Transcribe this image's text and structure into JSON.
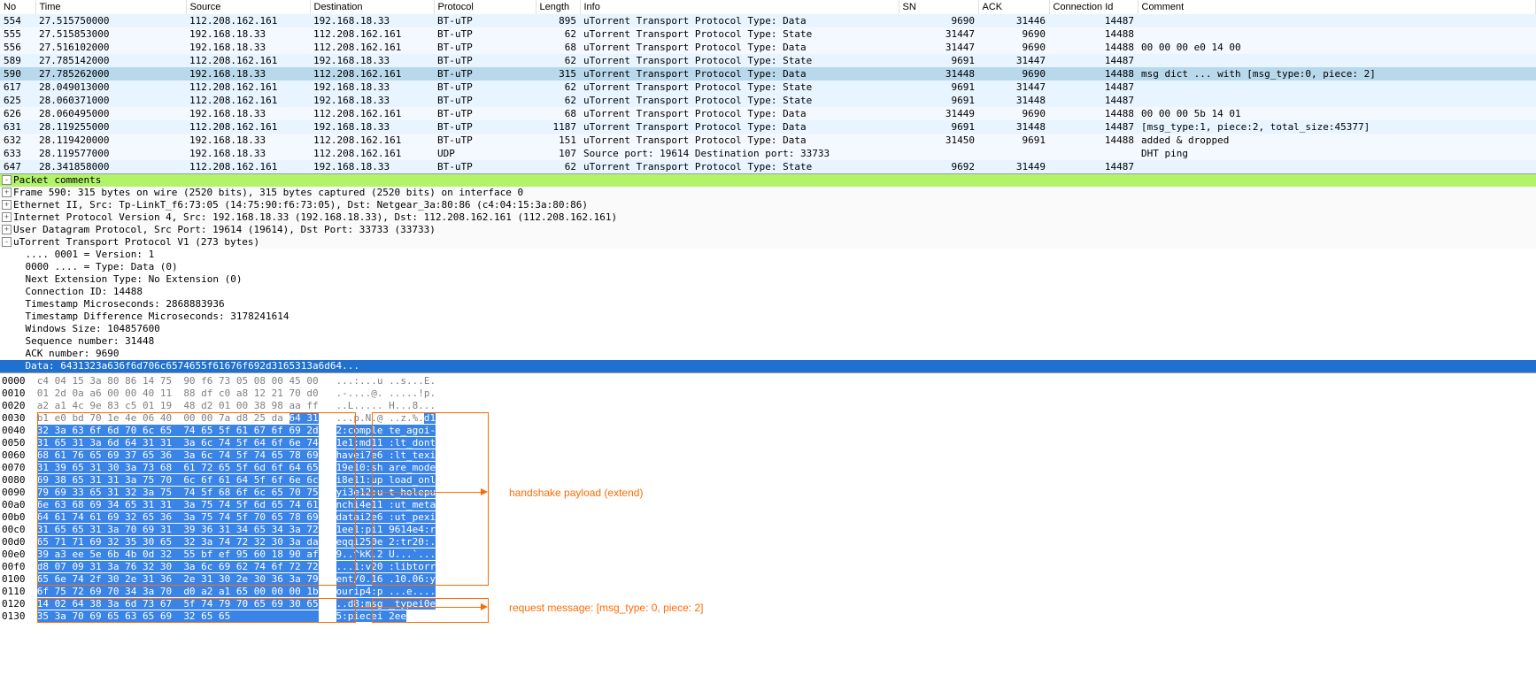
{
  "columns": {
    "no": "No",
    "time": "Time",
    "source": "Source",
    "destination": "Destination",
    "protocol": "Protocol",
    "length": "Length",
    "info": "Info",
    "sn": "SN",
    "ack": "ACK",
    "cid": "Connection Id",
    "comment": "Comment"
  },
  "rows": [
    {
      "no": "554",
      "time": "27.515750000",
      "src": "112.208.162.161",
      "dst": "192.168.18.33",
      "proto": "BT-uTP",
      "len": "895",
      "info": "uTorrent Transport Protocol Type: Data",
      "sn": "9690",
      "ack": "31446",
      "cid": "14487",
      "cmt": "",
      "cls": "row-ip1"
    },
    {
      "no": "555",
      "time": "27.515853000",
      "src": "192.168.18.33",
      "dst": "112.208.162.161",
      "proto": "BT-uTP",
      "len": "62",
      "info": "uTorrent Transport Protocol Type: State",
      "sn": "31447",
      "ack": "9690",
      "cid": "14488",
      "cmt": "",
      "cls": "row-ip2"
    },
    {
      "no": "556",
      "time": "27.516102000",
      "src": "192.168.18.33",
      "dst": "112.208.162.161",
      "proto": "BT-uTP",
      "len": "68",
      "info": "uTorrent Transport Protocol Type: Data",
      "sn": "31447",
      "ack": "9690",
      "cid": "14488",
      "cmt": "00 00 00 e0 14 00",
      "cls": "row-ip2"
    },
    {
      "no": "589",
      "time": "27.785142000",
      "src": "112.208.162.161",
      "dst": "192.168.18.33",
      "proto": "BT-uTP",
      "len": "62",
      "info": "uTorrent Transport Protocol Type: State",
      "sn": "9691",
      "ack": "31447",
      "cid": "14487",
      "cmt": "",
      "cls": "row-ip1"
    },
    {
      "no": "590",
      "time": "27.785262000",
      "src": "192.168.18.33",
      "dst": "112.208.162.161",
      "proto": "BT-uTP",
      "len": "315",
      "info": "uTorrent Transport Protocol Type: Data",
      "sn": "31448",
      "ack": "9690",
      "cid": "14488",
      "cmt": "msg dict ... with [msg_type:0, piece: 2]",
      "cls": "row-selected"
    },
    {
      "no": "617",
      "time": "28.049013000",
      "src": "112.208.162.161",
      "dst": "192.168.18.33",
      "proto": "BT-uTP",
      "len": "62",
      "info": "uTorrent Transport Protocol Type: State",
      "sn": "9691",
      "ack": "31447",
      "cid": "14487",
      "cmt": "",
      "cls": "row-ip1"
    },
    {
      "no": "625",
      "time": "28.060371000",
      "src": "112.208.162.161",
      "dst": "192.168.18.33",
      "proto": "BT-uTP",
      "len": "62",
      "info": "uTorrent Transport Protocol Type: State",
      "sn": "9691",
      "ack": "31448",
      "cid": "14487",
      "cmt": "",
      "cls": "row-ip1"
    },
    {
      "no": "626",
      "time": "28.060495000",
      "src": "192.168.18.33",
      "dst": "112.208.162.161",
      "proto": "BT-uTP",
      "len": "68",
      "info": "uTorrent Transport Protocol Type: Data",
      "sn": "31449",
      "ack": "9690",
      "cid": "14488",
      "cmt": "00 00 00 5b 14 01",
      "cls": "row-ip2"
    },
    {
      "no": "631",
      "time": "28.119255000",
      "src": "112.208.162.161",
      "dst": "192.168.18.33",
      "proto": "BT-uTP",
      "len": "1187",
      "info": "uTorrent Transport Protocol Type: Data",
      "sn": "9691",
      "ack": "31448",
      "cid": "14487",
      "cmt": "[msg_type:1, piece:2, total_size:45377]",
      "cls": "row-ip1"
    },
    {
      "no": "632",
      "time": "28.119420000",
      "src": "192.168.18.33",
      "dst": "112.208.162.161",
      "proto": "BT-uTP",
      "len": "151",
      "info": "uTorrent Transport Protocol Type: Data",
      "sn": "31450",
      "ack": "9691",
      "cid": "14488",
      "cmt": "added & dropped",
      "cls": "row-ip2"
    },
    {
      "no": "633",
      "time": "28.119577000",
      "src": "192.168.18.33",
      "dst": "112.208.162.161",
      "proto": "UDP",
      "len": "107",
      "info": "Source port: 19614  Destination port: 33733",
      "sn": "",
      "ack": "",
      "cid": "",
      "cmt": "DHT ping",
      "cls": "row-ip2"
    },
    {
      "no": "647",
      "time": "28.341858000",
      "src": "112.208.162.161",
      "dst": "192.168.18.33",
      "proto": "BT-uTP",
      "len": "62",
      "info": "uTorrent Transport Protocol Type: State",
      "sn": "9692",
      "ack": "31449",
      "cid": "14487",
      "cmt": "",
      "cls": "row-ip1"
    }
  ],
  "details": {
    "comments_hdr": "Packet comments",
    "lines": [
      "Frame 590: 315 bytes on wire (2520 bits), 315 bytes captured (2520 bits) on interface 0",
      "Ethernet II, Src: Tp-LinkT_f6:73:05 (14:75:90:f6:73:05), Dst: Netgear_3a:80:86 (c4:04:15:3a:80:86)",
      "Internet Protocol Version 4, Src: 192.168.18.33 (192.168.18.33), Dst: 112.208.162.161 (112.208.162.161)",
      "User Datagram Protocol, Src Port: 19614 (19614), Dst Port: 33733 (33733)",
      "uTorrent Transport Protocol V1 (273 bytes)"
    ],
    "utp": [
      ".... 0001 = Version: 1",
      "0000 .... = Type: Data (0)",
      "Next Extension Type: No Extension (0)",
      "Connection ID: 14488",
      "Timestamp Microseconds: 2868883936",
      "Timestamp Difference Microseconds: 3178241614",
      "Windows Size: 104857600",
      "Sequence number: 31448",
      "ACK number: 9690"
    ],
    "data_line": "Data: 6431323a636f6d706c6574655f61676f692d3165313a6d64..."
  },
  "hex": [
    {
      "off": "0000",
      "b": "c4 04 15 3a 80 86 14 75  90 f6 73 05 08 00 45 00",
      "a": "...:...u ..s...E.",
      "sel": false
    },
    {
      "off": "0010",
      "b": "01 2d 0a a6 00 00 40 11  88 df c0 a8 12 21 70 d0",
      "a": ".-....@. .....!p.",
      "sel": false
    },
    {
      "off": "0020",
      "b": "a2 a1 4c 9e 83 c5 01 19  48 d2 01 00 38 98 aa ff",
      "a": "..L..... H...8...",
      "sel": false
    },
    {
      "off": "0030",
      "b": "b1 e0 bd 70 1e 4e 06 40  00 00 7a d8 25 da ",
      "bs": "64 31",
      "a": "...p.N.@ ..z.%.",
      "as": "d1",
      "sel": "partial"
    },
    {
      "off": "0040",
      "b": "32 3a 63 6f 6d 70 6c 65  74 65 5f 61 67 6f 69 2d",
      "a": "2:comple te_agoi-",
      "sel": true
    },
    {
      "off": "0050",
      "b": "31 65 31 3a 6d 64 31 31  3a 6c 74 5f 64 6f 6e 74",
      "a": "1e1:md11 :lt_dont",
      "sel": true
    },
    {
      "off": "0060",
      "b": "68 61 76 65 69 37 65 36  3a 6c 74 5f 74 65 78 69",
      "a": "havei7e6 :lt_texi",
      "sel": true
    },
    {
      "off": "0070",
      "b": "31 39 65 31 30 3a 73 68  61 72 65 5f 6d 6f 64 65",
      "a": "19e10:sh are_mode",
      "sel": true
    },
    {
      "off": "0080",
      "b": "69 38 65 31 31 3a 75 70  6c 6f 61 64 5f 6f 6e 6c",
      "a": "i8e11:up load_onl",
      "sel": true
    },
    {
      "off": "0090",
      "b": "79 69 33 65 31 32 3a 75  74 5f 68 6f 6c 65 70 75",
      "a": "yi3e12:u t_holepu",
      "sel": true
    },
    {
      "off": "00a0",
      "b": "6e 63 68 69 34 65 31 31  3a 75 74 5f 6d 65 74 61",
      "a": "nchi4e11 :ut_meta",
      "sel": true
    },
    {
      "off": "00b0",
      "b": "64 61 74 61 69 32 65 36  3a 75 74 5f 70 65 78 69",
      "a": "datai2e6 :ut_pexi",
      "sel": true
    },
    {
      "off": "00c0",
      "b": "31 65 65 31 3a 70 69 31  39 36 31 34 65 34 3a 72",
      "a": "1ee1:pi1 9614e4:r",
      "sel": true
    },
    {
      "off": "00d0",
      "b": "65 71 71 69 32 35 30 65  32 3a 74 72 32 30 3a da",
      "a": "eqqi250e 2:tr20:.",
      "sel": true
    },
    {
      "off": "00e0",
      "b": "39 a3 ee 5e 6b 4b 0d 32  55 bf ef 95 60 18 90 af",
      "a": "9..^kK.2 U...`...",
      "sel": true
    },
    {
      "off": "00f0",
      "b": "d8 07 09 31 3a 76 32 30  3a 6c 69 62 74 6f 72 72",
      "a": "...1:v20 :libtorr",
      "sel": true
    },
    {
      "off": "0100",
      "b": "65 6e 74 2f 30 2e 31 36  2e 31 30 2e 30 36 3a 79",
      "a": "ent/0.16 .10.06:y",
      "sel": true
    },
    {
      "off": "0110",
      "b": "6f 75 72 69 70 34 3a 70  d0 a2 a1 65 ",
      "bs": "00 00 00 1b",
      "a": "ourip4:p ...e",
      "as": "....",
      "sel": "partial2"
    },
    {
      "off": "0120",
      "b": "14 02 64 38 3a 6d 73 67  5f 74 79 70 65 69 30 65",
      "a": "..d8:msg _typei0e",
      "sel": true
    },
    {
      "off": "0130",
      "b": "35 3a 70 69 65 63 65 69  32 65 65",
      "a": "5:piecei 2ee",
      "sel": true
    }
  ],
  "annotations": {
    "handshake": "handshake payload (extend)",
    "request": "request message: [msg_type: 0, piece: 2]"
  }
}
